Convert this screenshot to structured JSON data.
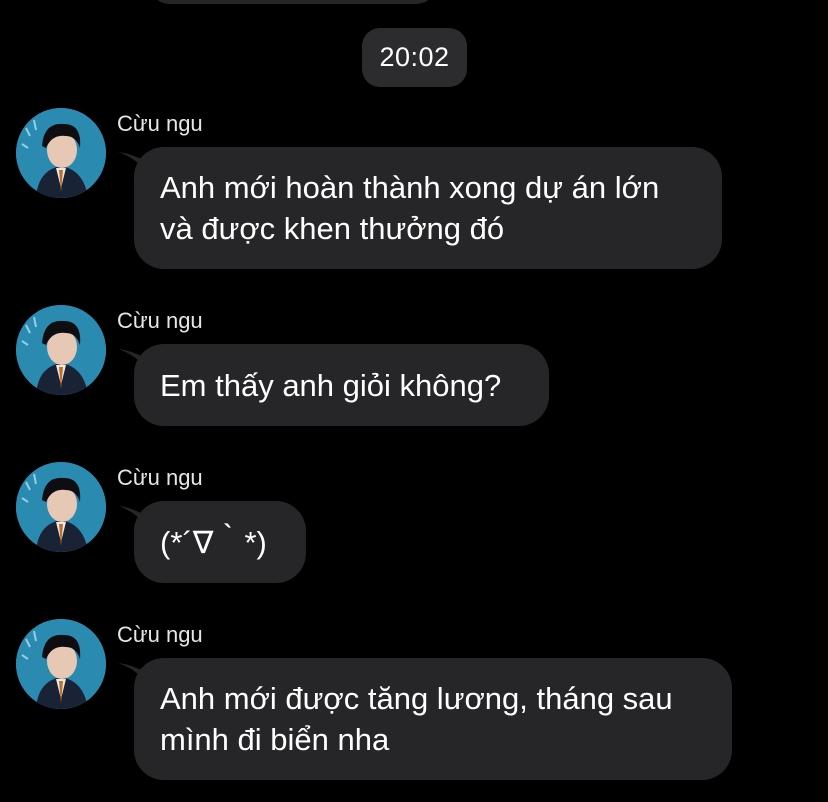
{
  "timestamp": "20:02",
  "colors": {
    "background": "#000000",
    "bubble": "#262628",
    "time_pill": "#2c2c2e",
    "avatar_bg": "#2a8ab0"
  },
  "messages": [
    {
      "sender": "Cừu ngu",
      "lines": [
        "Anh mới hoàn thành xong dự án lớn",
        "và được khen thưởng đó"
      ]
    },
    {
      "sender": "Cừu ngu",
      "lines": [
        "Em thấy anh giỏi không?"
      ]
    },
    {
      "sender": "Cừu ngu",
      "lines": [
        "(*´∇｀*)"
      ]
    },
    {
      "sender": "Cừu ngu",
      "lines": [
        "Anh mới được tăng lương, tháng sau",
        "mình đi biển nha"
      ]
    }
  ]
}
